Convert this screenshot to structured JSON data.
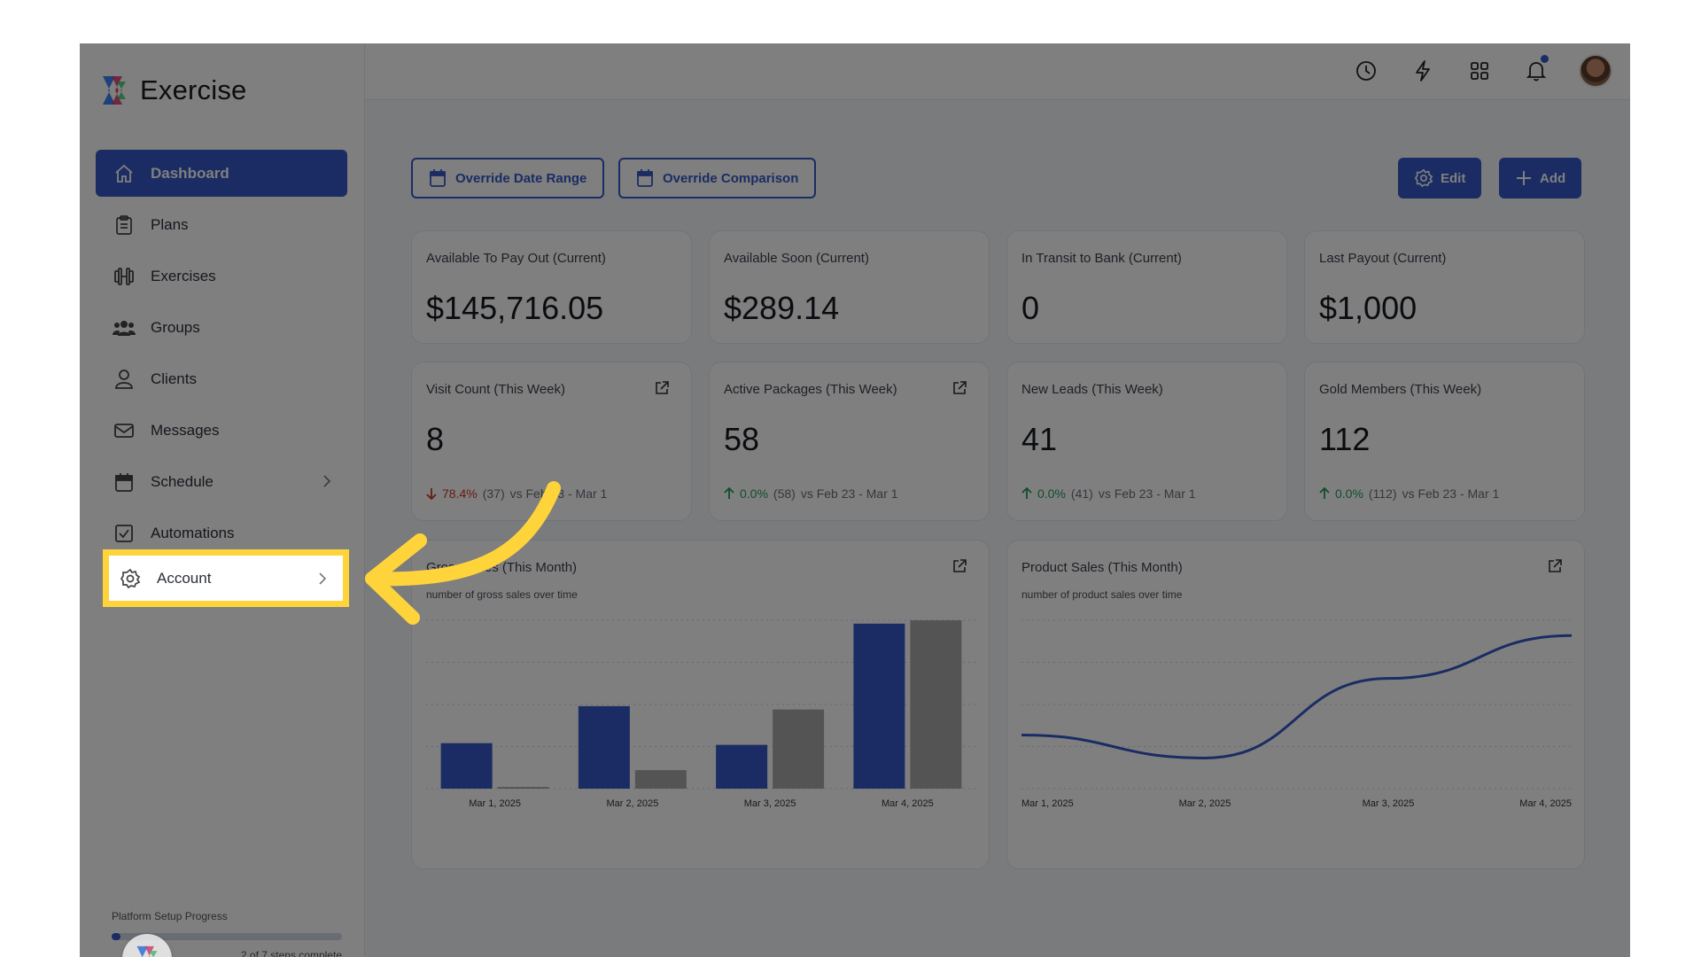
{
  "app": {
    "brand": "Exercise"
  },
  "sidebar": {
    "items": [
      {
        "label": "Dashboard",
        "icon": "home-icon",
        "active": true
      },
      {
        "label": "Plans",
        "icon": "clipboard-icon"
      },
      {
        "label": "Exercises",
        "icon": "dumbbell-icon"
      },
      {
        "label": "Groups",
        "icon": "users-icon"
      },
      {
        "label": "Clients",
        "icon": "user-icon"
      },
      {
        "label": "Messages",
        "icon": "mail-icon"
      },
      {
        "label": "Schedule",
        "icon": "calendar-icon",
        "expandable": true
      },
      {
        "label": "Automations",
        "icon": "checkbox-icon"
      },
      {
        "label": "Account",
        "icon": "gear-icon",
        "expandable": true
      }
    ],
    "progress": {
      "label": "Platform Setup Progress",
      "sub": "2 of 7 steps complete",
      "fraction": 0.04
    }
  },
  "toolbar": {
    "override_date_range": "Override Date Range",
    "override_comparison": "Override Comparison",
    "edit": "Edit",
    "add": "Add"
  },
  "stats_top": [
    {
      "label": "Available To Pay Out (Current)",
      "value": "$145,716.05"
    },
    {
      "label": "Available Soon (Current)",
      "value": "$289.14"
    },
    {
      "label": "In Transit to Bank (Current)",
      "value": "0"
    },
    {
      "label": "Last Payout (Current)",
      "value": "$1,000"
    }
  ],
  "stats_week": [
    {
      "label": "Visit Count (This Week)",
      "value": "8",
      "pct": "78.4%",
      "dir": "down",
      "prev": "(37)",
      "vs": "vs Feb 23 - Mar 1"
    },
    {
      "label": "Active Packages (This Week)",
      "value": "58",
      "pct": "0.0%",
      "dir": "up",
      "prev": "(58)",
      "vs": "vs Feb 23 - Mar 1"
    },
    {
      "label": "New Leads (This Week)",
      "value": "41",
      "pct": "0.0%",
      "dir": "up",
      "prev": "(41)",
      "vs": "vs Feb 23 - Mar 1"
    },
    {
      "label": "Gold Members (This Week)",
      "value": "112",
      "pct": "0.0%",
      "dir": "up",
      "prev": "(112)",
      "vs": "vs Feb 23 - Mar 1"
    }
  ],
  "colors": {
    "primary": "#3559c7",
    "secondary_bar": "#a9a9a9",
    "highlight": "#ffd43b"
  },
  "chart_data": [
    {
      "type": "bar",
      "title": "Gross Sales (This Month)",
      "subtitle": "number of gross sales over time",
      "categories": [
        "Mar 1, 2025",
        "Mar 2, 2025",
        "Mar 3, 2025",
        "Mar 4, 2025"
      ],
      "series": [
        {
          "values": [
            27,
            49,
            26,
            98
          ]
        },
        {
          "values": [
            1,
            11,
            47,
            100
          ]
        }
      ],
      "ylim": [
        0,
        100
      ]
    },
    {
      "type": "line",
      "title": "Product Sales (This Month)",
      "subtitle": "number of product sales over time",
      "categories": [
        "Mar 1, 2025",
        "Mar 2, 2025",
        "Mar 3, 2025",
        "Mar 4, 2025"
      ],
      "series": [
        {
          "values": [
            35,
            20,
            72,
            100
          ]
        }
      ],
      "ylim": [
        0,
        110
      ]
    }
  ]
}
